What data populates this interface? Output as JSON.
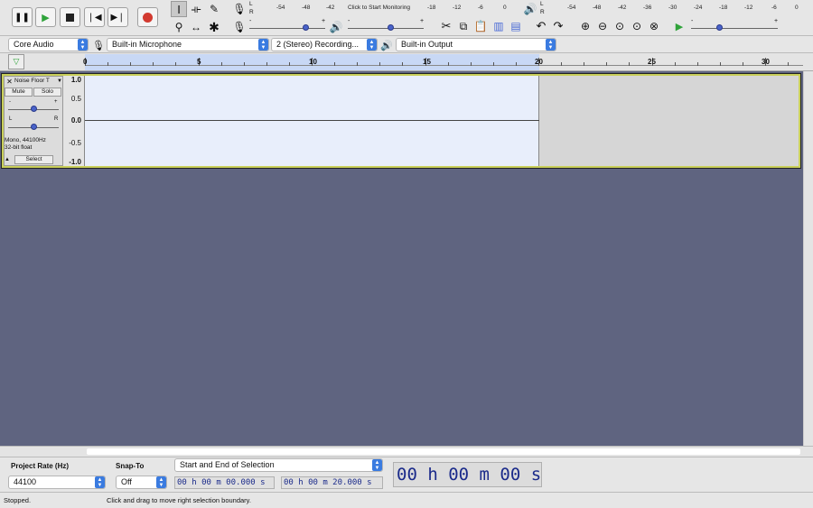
{
  "transport": {
    "pause": "pause",
    "play": "play",
    "stop": "stop",
    "skip_start": "skip-to-start",
    "skip_end": "skip-to-end",
    "record": "record"
  },
  "meter": {
    "record_label_l": "L",
    "record_label_r": "R",
    "record_ticks": [
      "-54",
      "-48",
      "-42",
      "Click to Start Monitoring",
      "-18",
      "-12",
      "-6",
      "0"
    ],
    "play_ticks": [
      "-54",
      "-48",
      "-42",
      "-36",
      "-30",
      "-24",
      "-18",
      "-12",
      "-6",
      "0"
    ]
  },
  "devices": {
    "host": "Core Audio",
    "input": "Built-in Microphone",
    "channels": "2 (Stereo) Recording...",
    "output": "Built-in Output"
  },
  "ruler": {
    "ticks": [
      "0",
      "5",
      "10",
      "15",
      "20",
      "25",
      "30"
    ]
  },
  "track": {
    "name": "Noise Floor T",
    "mute": "Mute",
    "solo": "Solo",
    "gain_minus": "-",
    "gain_plus": "+",
    "pan_left": "L",
    "pan_right": "R",
    "info1": "Mono, 44100Hz",
    "info2": "32-bit float",
    "select": "Select",
    "scale": [
      "1.0",
      "0.5",
      "0.0",
      "-0.5",
      "-1.0"
    ],
    "gain": 0.5,
    "pan": 0.5
  },
  "bottom": {
    "rate_label": "Project Rate (Hz)",
    "rate_value": "44100",
    "snap_label": "Snap-To",
    "snap_value": "Off",
    "selection_mode": "Start and End of Selection",
    "sel_start": "00 h 00 m 00.000 s",
    "sel_end": "00 h 00 m 20.000 s",
    "big_time": "00 h 00 m 00 s"
  },
  "status": {
    "left": "Stopped.",
    "right": "Click and drag to move right selection boundary."
  },
  "colors": {
    "track_bg": "#e8eefb",
    "empty_area": "#5f6480",
    "track_border": "#c9cf5a",
    "selection_blue": "#c2d6f7"
  }
}
